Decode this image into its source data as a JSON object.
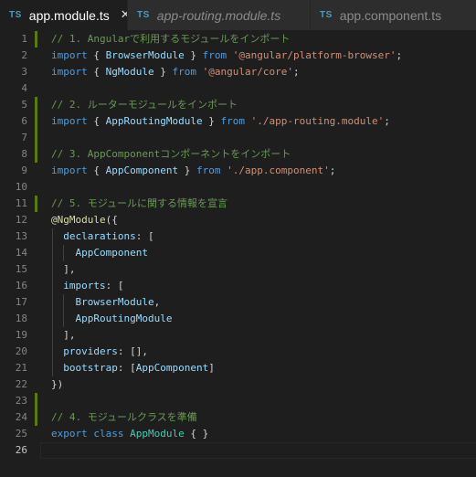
{
  "tabs": [
    {
      "icon": "TS",
      "label": "app.module.ts",
      "active": true,
      "close": "✕"
    },
    {
      "icon": "TS",
      "label": "app-routing.module.ts",
      "active": false
    },
    {
      "icon": "TS",
      "label": "app.component.ts",
      "active": false
    }
  ],
  "lines": [
    {
      "n": "1",
      "mod": true,
      "tokens": [
        {
          "c": "comment",
          "t": "// 1. Angularで利用するモジュールをインポート"
        }
      ]
    },
    {
      "n": "2",
      "mod": false,
      "tokens": [
        {
          "c": "kw",
          "t": "import"
        },
        {
          "c": "punc",
          "t": " { "
        },
        {
          "c": "ident",
          "t": "BrowserModule"
        },
        {
          "c": "punc",
          "t": " } "
        },
        {
          "c": "kw",
          "t": "from"
        },
        {
          "c": "punc",
          "t": " "
        },
        {
          "c": "str",
          "t": "'@angular/platform-browser'"
        },
        {
          "c": "punc",
          "t": ";"
        }
      ]
    },
    {
      "n": "3",
      "mod": false,
      "tokens": [
        {
          "c": "kw",
          "t": "import"
        },
        {
          "c": "punc",
          "t": " { "
        },
        {
          "c": "ident",
          "t": "NgModule"
        },
        {
          "c": "punc",
          "t": " } "
        },
        {
          "c": "kw",
          "t": "from"
        },
        {
          "c": "punc",
          "t": " "
        },
        {
          "c": "str",
          "t": "'@angular/core'"
        },
        {
          "c": "punc",
          "t": ";"
        }
      ]
    },
    {
      "n": "4",
      "mod": false,
      "tokens": []
    },
    {
      "n": "5",
      "mod": true,
      "tokens": [
        {
          "c": "comment",
          "t": "// 2. ルーターモジュールをインポート"
        }
      ]
    },
    {
      "n": "6",
      "mod": true,
      "tokens": [
        {
          "c": "kw",
          "t": "import"
        },
        {
          "c": "punc",
          "t": " { "
        },
        {
          "c": "ident",
          "t": "AppRoutingModule"
        },
        {
          "c": "punc",
          "t": " } "
        },
        {
          "c": "kw",
          "t": "from"
        },
        {
          "c": "punc",
          "t": " "
        },
        {
          "c": "str",
          "t": "'./app-routing.module'"
        },
        {
          "c": "punc",
          "t": ";"
        }
      ]
    },
    {
      "n": "7",
      "mod": true,
      "tokens": []
    },
    {
      "n": "8",
      "mod": true,
      "tokens": [
        {
          "c": "comment",
          "t": "// 3. AppComponentコンポーネントをインポート"
        }
      ]
    },
    {
      "n": "9",
      "mod": false,
      "tokens": [
        {
          "c": "kw",
          "t": "import"
        },
        {
          "c": "punc",
          "t": " { "
        },
        {
          "c": "ident",
          "t": "AppComponent"
        },
        {
          "c": "punc",
          "t": " } "
        },
        {
          "c": "kw",
          "t": "from"
        },
        {
          "c": "punc",
          "t": " "
        },
        {
          "c": "str",
          "t": "'./app.component'"
        },
        {
          "c": "punc",
          "t": ";"
        }
      ]
    },
    {
      "n": "10",
      "mod": false,
      "tokens": []
    },
    {
      "n": "11",
      "mod": true,
      "tokens": [
        {
          "c": "comment",
          "t": "// 5. モジュールに関する情報を宣言"
        }
      ]
    },
    {
      "n": "12",
      "mod": false,
      "tokens": [
        {
          "c": "deco",
          "t": "@NgModule"
        },
        {
          "c": "punc",
          "t": "({"
        }
      ]
    },
    {
      "n": "13",
      "mod": false,
      "guides": 1,
      "tokens": [
        {
          "c": "punc",
          "t": "  "
        },
        {
          "c": "ident",
          "t": "declarations"
        },
        {
          "c": "punc",
          "t": ": ["
        }
      ]
    },
    {
      "n": "14",
      "mod": false,
      "guides": 2,
      "tokens": [
        {
          "c": "punc",
          "t": "    "
        },
        {
          "c": "ident",
          "t": "AppComponent"
        }
      ]
    },
    {
      "n": "15",
      "mod": false,
      "guides": 1,
      "tokens": [
        {
          "c": "punc",
          "t": "  ],"
        }
      ]
    },
    {
      "n": "16",
      "mod": false,
      "guides": 1,
      "tokens": [
        {
          "c": "punc",
          "t": "  "
        },
        {
          "c": "ident",
          "t": "imports"
        },
        {
          "c": "punc",
          "t": ": ["
        }
      ]
    },
    {
      "n": "17",
      "mod": false,
      "guides": 2,
      "tokens": [
        {
          "c": "punc",
          "t": "    "
        },
        {
          "c": "ident",
          "t": "BrowserModule"
        },
        {
          "c": "punc",
          "t": ","
        }
      ]
    },
    {
      "n": "18",
      "mod": false,
      "guides": 2,
      "tokens": [
        {
          "c": "punc",
          "t": "    "
        },
        {
          "c": "ident",
          "t": "AppRoutingModule"
        }
      ]
    },
    {
      "n": "19",
      "mod": false,
      "guides": 1,
      "tokens": [
        {
          "c": "punc",
          "t": "  ],"
        }
      ]
    },
    {
      "n": "20",
      "mod": false,
      "guides": 1,
      "tokens": [
        {
          "c": "punc",
          "t": "  "
        },
        {
          "c": "ident",
          "t": "providers"
        },
        {
          "c": "punc",
          "t": ": [],"
        }
      ]
    },
    {
      "n": "21",
      "mod": false,
      "guides": 1,
      "tokens": [
        {
          "c": "punc",
          "t": "  "
        },
        {
          "c": "ident",
          "t": "bootstrap"
        },
        {
          "c": "punc",
          "t": ": ["
        },
        {
          "c": "ident",
          "t": "AppComponent"
        },
        {
          "c": "punc",
          "t": "]"
        }
      ]
    },
    {
      "n": "22",
      "mod": false,
      "tokens": [
        {
          "c": "punc",
          "t": "})"
        }
      ]
    },
    {
      "n": "23",
      "mod": true,
      "tokens": []
    },
    {
      "n": "24",
      "mod": true,
      "tokens": [
        {
          "c": "comment",
          "t": "// 4. モジュールクラスを準備"
        }
      ]
    },
    {
      "n": "25",
      "mod": false,
      "tokens": [
        {
          "c": "kw",
          "t": "export"
        },
        {
          "c": "punc",
          "t": " "
        },
        {
          "c": "kw",
          "t": "class"
        },
        {
          "c": "punc",
          "t": " "
        },
        {
          "c": "cls",
          "t": "AppModule"
        },
        {
          "c": "punc",
          "t": " { }"
        }
      ]
    },
    {
      "n": "26",
      "mod": false,
      "current": true,
      "tokens": []
    }
  ]
}
